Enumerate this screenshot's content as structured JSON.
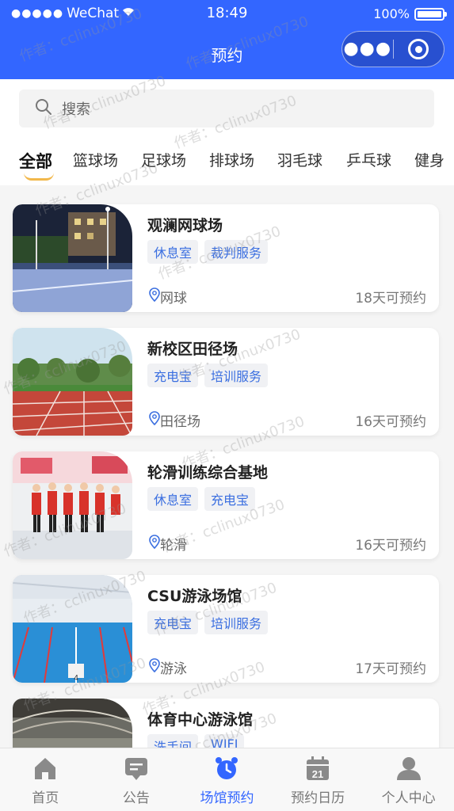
{
  "status_bar": {
    "carrier": "WeChat",
    "time": "18:49",
    "battery": "100%"
  },
  "nav": {
    "title": "预约"
  },
  "search": {
    "placeholder": "搜索"
  },
  "category_tabs": [
    "全部",
    "篮球场",
    "足球场",
    "排球场",
    "羽毛球",
    "乒乓球",
    "健身"
  ],
  "venues": [
    {
      "name": "观澜网球场",
      "tags": [
        "休息室",
        "裁判服务"
      ],
      "sport": "网球",
      "availability": "18天可预约"
    },
    {
      "name": "新校区田径场",
      "tags": [
        "充电宝",
        "培训服务"
      ],
      "sport": "田径场",
      "availability": "16天可预约"
    },
    {
      "name": "轮滑训练综合基地",
      "tags": [
        "休息室",
        "充电宝"
      ],
      "sport": "轮滑",
      "availability": "16天可预约"
    },
    {
      "name": "CSU游泳场馆",
      "tags": [
        "充电宝",
        "培训服务"
      ],
      "sport": "游泳",
      "availability": "17天可预约"
    },
    {
      "name": "体育中心游泳馆",
      "tags": [
        "洗手间",
        "WIFI"
      ],
      "sport": "",
      "availability": ""
    }
  ],
  "thumb_labels": {
    "pool_lane": "4"
  },
  "tabbar": [
    {
      "label": "首页",
      "icon": "home-icon"
    },
    {
      "label": "公告",
      "icon": "notice-icon"
    },
    {
      "label": "场馆预约",
      "icon": "alarm-clock-icon",
      "active": true
    },
    {
      "label": "预约日历",
      "icon": "calendar-icon"
    },
    {
      "label": "个人中心",
      "icon": "user-icon"
    }
  ],
  "watermark": "作者：cclinux0730",
  "colors": {
    "primary": "#3366ff",
    "tag_text": "#3b6fe0",
    "tab_underline": "#f2b84b"
  }
}
